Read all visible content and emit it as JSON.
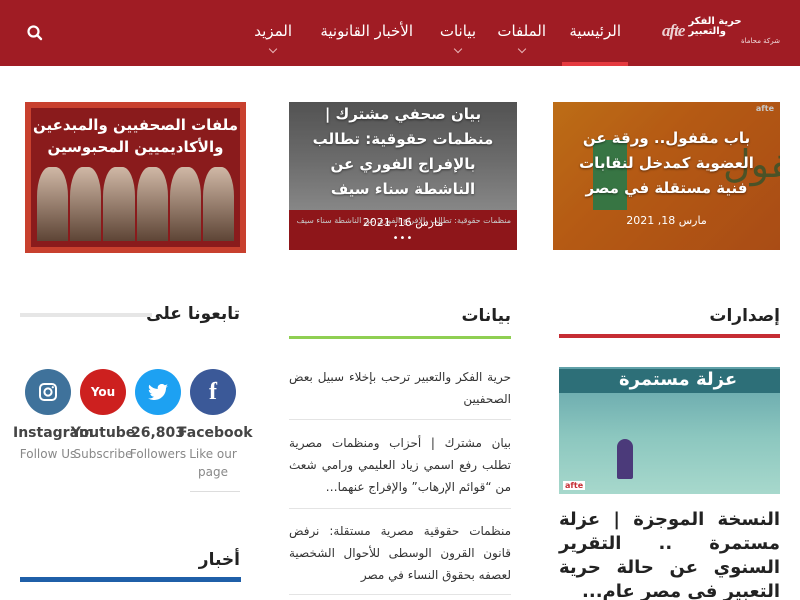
{
  "header": {
    "logo_title": "حرية الفكر والتعبير",
    "logo_subtitle": "شركة محاماة",
    "logo_mark": "afte",
    "nav": [
      {
        "label": "الرئيسية",
        "has_dropdown": false,
        "active": true
      },
      {
        "label": "الملفات",
        "has_dropdown": true,
        "active": false
      },
      {
        "label": "بيانات",
        "has_dropdown": true,
        "active": false
      },
      {
        "label": "الأخبار القانونية",
        "has_dropdown": false,
        "active": false
      },
      {
        "label": "المزيد",
        "has_dropdown": true,
        "active": false
      }
    ],
    "search_icon": "search-icon",
    "colors": {
      "bar": "#a01c24",
      "active": "#e53a3f"
    }
  },
  "featured": [
    {
      "title": "باب مقفول.. ورقة عن العضوية كمدخل لنقابات فنية مستقلة في مصر",
      "date": "مارس 18, 2021",
      "image_word": "مقفول",
      "brand": "afte"
    },
    {
      "title": "بيان صحفي مشترك | منظمات حقوقية: تطالب بالإفراج الفوري عن الناشطة سناء سيف",
      "date": "مارس 16, 2021",
      "strip_text": "منظمات حقوقية: تطالب بالإفراج الفوري عن الناشطة سناء سيف"
    },
    {
      "headline": "ملفات الصحفيين والمبدعين والأكاديميين المحبوسين"
    }
  ],
  "sections": {
    "releases": "إصدارات",
    "statements": "بيانات",
    "follow": "تابعونا على",
    "news": "أخبار"
  },
  "social": [
    {
      "icon": "facebook-icon",
      "glyph": "f",
      "name": "Facebook",
      "sub": "Like our page",
      "count": ""
    },
    {
      "icon": "twitter-icon",
      "glyph": "🐦",
      "name": "26,803",
      "sub": "Followers",
      "count": "26,803"
    },
    {
      "icon": "youtube-icon",
      "glyph": "You",
      "name": "Youtube",
      "sub": "Subscribe",
      "count": ""
    },
    {
      "icon": "instagram-icon",
      "glyph": "◎",
      "name": "Instagram",
      "sub": "Follow Us",
      "count": ""
    }
  ],
  "statements_list": [
    "حرية الفكر والتعبير ترحب بإخلاء سبيل بعض الصحفيين",
    "بيان مشترك | أحزاب ومنظمات مصرية تطلب رفع اسمي زياد العليمي ورامي شعث من “قوائم الإرهاب” والإفراج عنهما…",
    "منظمات حقوقية مصرية مستقلة: نرفض قانون القرون الوسطى للأحوال الشخصية لعصفه بحقوق النساء في مصر"
  ],
  "release": {
    "image_text": "عزلة مستمرة",
    "image_tag": "afte",
    "title": "النسخة الموجزة | عزلة مستمرة .. التقرير السنوي عن حالة حرية التعبير في مصر عام..."
  }
}
